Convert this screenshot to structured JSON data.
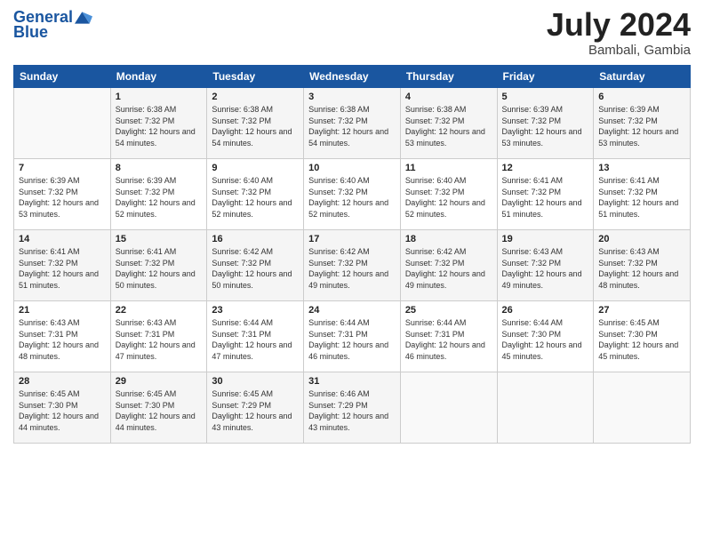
{
  "header": {
    "logo_line1": "General",
    "logo_line2": "Blue",
    "month": "July 2024",
    "location": "Bambali, Gambia"
  },
  "weekdays": [
    "Sunday",
    "Monday",
    "Tuesday",
    "Wednesday",
    "Thursday",
    "Friday",
    "Saturday"
  ],
  "weeks": [
    [
      {
        "day": "",
        "sunrise": "",
        "sunset": "",
        "daylight": ""
      },
      {
        "day": "1",
        "sunrise": "6:38 AM",
        "sunset": "7:32 PM",
        "daylight": "12 hours and 54 minutes."
      },
      {
        "day": "2",
        "sunrise": "6:38 AM",
        "sunset": "7:32 PM",
        "daylight": "12 hours and 54 minutes."
      },
      {
        "day": "3",
        "sunrise": "6:38 AM",
        "sunset": "7:32 PM",
        "daylight": "12 hours and 54 minutes."
      },
      {
        "day": "4",
        "sunrise": "6:38 AM",
        "sunset": "7:32 PM",
        "daylight": "12 hours and 53 minutes."
      },
      {
        "day": "5",
        "sunrise": "6:39 AM",
        "sunset": "7:32 PM",
        "daylight": "12 hours and 53 minutes."
      },
      {
        "day": "6",
        "sunrise": "6:39 AM",
        "sunset": "7:32 PM",
        "daylight": "12 hours and 53 minutes."
      }
    ],
    [
      {
        "day": "7",
        "sunrise": "6:39 AM",
        "sunset": "7:32 PM",
        "daylight": "12 hours and 53 minutes."
      },
      {
        "day": "8",
        "sunrise": "6:39 AM",
        "sunset": "7:32 PM",
        "daylight": "12 hours and 52 minutes."
      },
      {
        "day": "9",
        "sunrise": "6:40 AM",
        "sunset": "7:32 PM",
        "daylight": "12 hours and 52 minutes."
      },
      {
        "day": "10",
        "sunrise": "6:40 AM",
        "sunset": "7:32 PM",
        "daylight": "12 hours and 52 minutes."
      },
      {
        "day": "11",
        "sunrise": "6:40 AM",
        "sunset": "7:32 PM",
        "daylight": "12 hours and 52 minutes."
      },
      {
        "day": "12",
        "sunrise": "6:41 AM",
        "sunset": "7:32 PM",
        "daylight": "12 hours and 51 minutes."
      },
      {
        "day": "13",
        "sunrise": "6:41 AM",
        "sunset": "7:32 PM",
        "daylight": "12 hours and 51 minutes."
      }
    ],
    [
      {
        "day": "14",
        "sunrise": "6:41 AM",
        "sunset": "7:32 PM",
        "daylight": "12 hours and 51 minutes."
      },
      {
        "day": "15",
        "sunrise": "6:41 AM",
        "sunset": "7:32 PM",
        "daylight": "12 hours and 50 minutes."
      },
      {
        "day": "16",
        "sunrise": "6:42 AM",
        "sunset": "7:32 PM",
        "daylight": "12 hours and 50 minutes."
      },
      {
        "day": "17",
        "sunrise": "6:42 AM",
        "sunset": "7:32 PM",
        "daylight": "12 hours and 49 minutes."
      },
      {
        "day": "18",
        "sunrise": "6:42 AM",
        "sunset": "7:32 PM",
        "daylight": "12 hours and 49 minutes."
      },
      {
        "day": "19",
        "sunrise": "6:43 AM",
        "sunset": "7:32 PM",
        "daylight": "12 hours and 49 minutes."
      },
      {
        "day": "20",
        "sunrise": "6:43 AM",
        "sunset": "7:32 PM",
        "daylight": "12 hours and 48 minutes."
      }
    ],
    [
      {
        "day": "21",
        "sunrise": "6:43 AM",
        "sunset": "7:31 PM",
        "daylight": "12 hours and 48 minutes."
      },
      {
        "day": "22",
        "sunrise": "6:43 AM",
        "sunset": "7:31 PM",
        "daylight": "12 hours and 47 minutes."
      },
      {
        "day": "23",
        "sunrise": "6:44 AM",
        "sunset": "7:31 PM",
        "daylight": "12 hours and 47 minutes."
      },
      {
        "day": "24",
        "sunrise": "6:44 AM",
        "sunset": "7:31 PM",
        "daylight": "12 hours and 46 minutes."
      },
      {
        "day": "25",
        "sunrise": "6:44 AM",
        "sunset": "7:31 PM",
        "daylight": "12 hours and 46 minutes."
      },
      {
        "day": "26",
        "sunrise": "6:44 AM",
        "sunset": "7:30 PM",
        "daylight": "12 hours and 45 minutes."
      },
      {
        "day": "27",
        "sunrise": "6:45 AM",
        "sunset": "7:30 PM",
        "daylight": "12 hours and 45 minutes."
      }
    ],
    [
      {
        "day": "28",
        "sunrise": "6:45 AM",
        "sunset": "7:30 PM",
        "daylight": "12 hours and 44 minutes."
      },
      {
        "day": "29",
        "sunrise": "6:45 AM",
        "sunset": "7:30 PM",
        "daylight": "12 hours and 44 minutes."
      },
      {
        "day": "30",
        "sunrise": "6:45 AM",
        "sunset": "7:29 PM",
        "daylight": "12 hours and 43 minutes."
      },
      {
        "day": "31",
        "sunrise": "6:46 AM",
        "sunset": "7:29 PM",
        "daylight": "12 hours and 43 minutes."
      },
      {
        "day": "",
        "sunrise": "",
        "sunset": "",
        "daylight": ""
      },
      {
        "day": "",
        "sunrise": "",
        "sunset": "",
        "daylight": ""
      },
      {
        "day": "",
        "sunrise": "",
        "sunset": "",
        "daylight": ""
      }
    ]
  ]
}
